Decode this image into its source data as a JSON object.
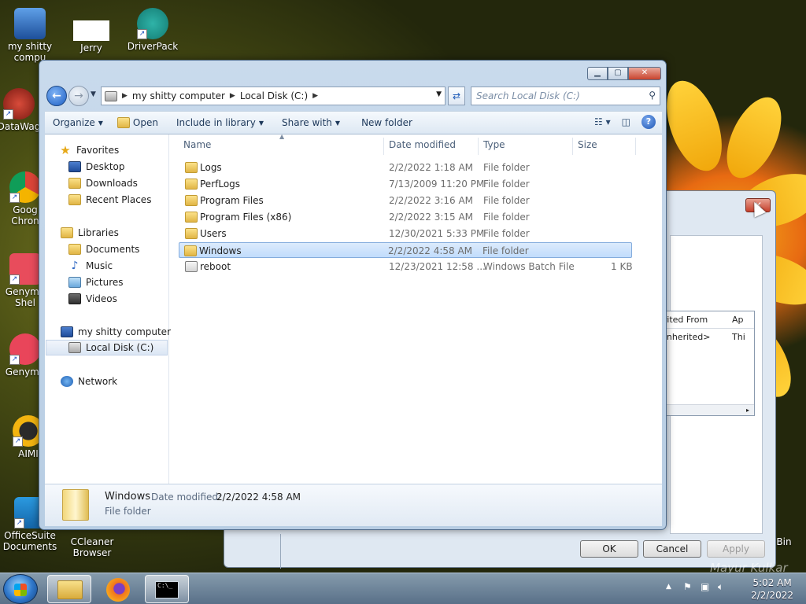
{
  "desktop": {
    "icons": [
      {
        "label": "my shitty\ncompu"
      },
      {
        "label": "Jerry"
      },
      {
        "label": "DriverPack"
      },
      {
        "label": "DataWag"
      },
      {
        "label": "Goog\nChron"
      },
      {
        "label": "Genymo\nShel"
      },
      {
        "label": "Genymo"
      },
      {
        "label": "AIMI"
      },
      {
        "label": "OfficeSuite\nDocuments"
      },
      {
        "label": "CCleaner\nBrowser"
      },
      {
        "label": "Bin"
      }
    ]
  },
  "bg_dialog": {
    "col_inherited": "erited From",
    "col_applies": "Ap",
    "cell_inherited": "t inherited>",
    "cell_applies": "Thi",
    "ok": "OK",
    "cancel": "Cancel",
    "apply": "Apply",
    "close_glyph": "✕"
  },
  "window": {
    "address": {
      "crumb1": "my shitty computer",
      "crumb2": "Local Disk (C:)"
    },
    "search_placeholder": "Search Local Disk (C:)",
    "toolbar": {
      "organize": "Organize",
      "open": "Open",
      "include_in_library": "Include in library",
      "share_with": "Share with",
      "new_folder": "New folder"
    },
    "nav": {
      "favorites": "Favorites",
      "desktop": "Desktop",
      "downloads": "Downloads",
      "recent_places": "Recent Places",
      "libraries": "Libraries",
      "documents": "Documents",
      "music": "Music",
      "pictures": "Pictures",
      "videos": "Videos",
      "computer": "my shitty computer",
      "local_disk": "Local Disk (C:)",
      "network": "Network"
    },
    "columns": {
      "name": "Name",
      "date": "Date modified",
      "type": "Type",
      "size": "Size"
    },
    "files": [
      {
        "name": "Logs",
        "date": "2/2/2022 1:18 AM",
        "type": "File folder",
        "size": ""
      },
      {
        "name": "PerfLogs",
        "date": "7/13/2009 11:20 PM",
        "type": "File folder",
        "size": ""
      },
      {
        "name": "Program Files",
        "date": "2/2/2022 3:16 AM",
        "type": "File folder",
        "size": ""
      },
      {
        "name": "Program Files (x86)",
        "date": "2/2/2022 3:15 AM",
        "type": "File folder",
        "size": ""
      },
      {
        "name": "Users",
        "date": "12/30/2021 5:33 PM",
        "type": "File folder",
        "size": ""
      },
      {
        "name": "Windows",
        "date": "2/2/2022 4:58 AM",
        "type": "File folder",
        "size": ""
      },
      {
        "name": "reboot",
        "date": "12/23/2021 12:58 ...",
        "type": "Windows Batch File",
        "size": "1 KB"
      }
    ],
    "details": {
      "name": "Windows",
      "date_label": "Date modified:",
      "date_value": "2/2/2022 4:58 AM",
      "type": "File folder"
    }
  },
  "taskbar": {
    "time": "5:02 AM",
    "date": "2/2/2022"
  },
  "watermark": "Mayur Kulkar"
}
